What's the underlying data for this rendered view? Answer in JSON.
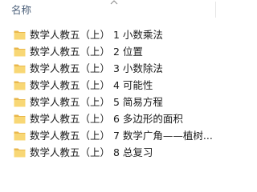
{
  "header": {
    "name_column": "名称"
  },
  "icons": {
    "folder": "folder-icon",
    "sort": "chevron-up-icon"
  },
  "colors": {
    "folder_body": "#f8d775",
    "folder_back": "#e9b74b",
    "header_text": "#4c607a",
    "item_text": "#1a1a1a"
  },
  "items": [
    {
      "label": "数学人教五（上） 1 小数乘法"
    },
    {
      "label": "数学人教五（上） 2 位置"
    },
    {
      "label": "数学人教五（上） 3 小数除法"
    },
    {
      "label": "数学人教五（上） 4 可能性"
    },
    {
      "label": "数学人教五（上） 5 简易方程"
    },
    {
      "label": "数学人教五（上） 6 多边形的面积"
    },
    {
      "label": "数学人教五（上） 7 数学广角——植树..."
    },
    {
      "label": "数学人教五（上） 8 总复习"
    }
  ]
}
